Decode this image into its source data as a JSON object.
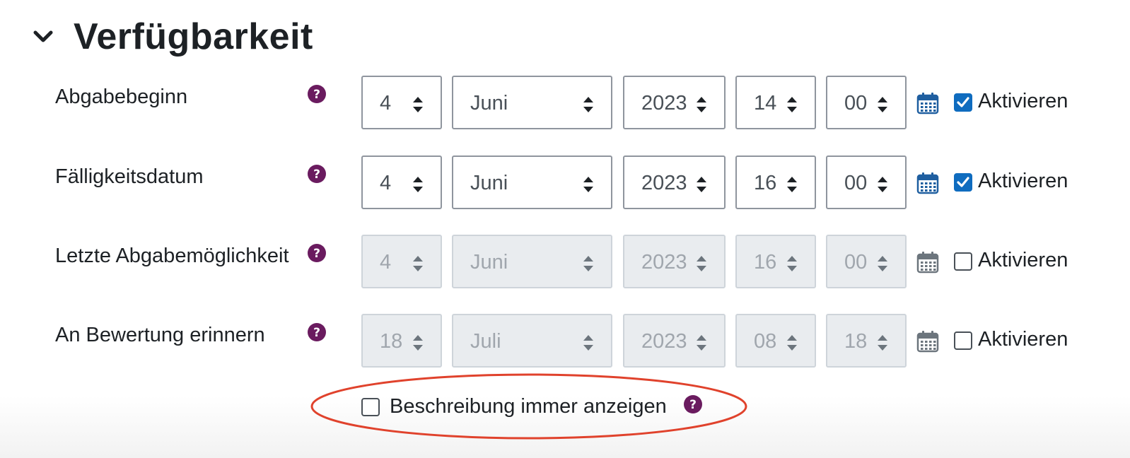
{
  "section": {
    "title": "Verfügbarkeit",
    "icon": "chevron-down-icon"
  },
  "rows": [
    {
      "label": "Abgabebeginn",
      "day": "4",
      "month": "Juni",
      "year": "2023",
      "hour": "14",
      "minute": "00",
      "enabled": true,
      "enable_label": "Aktivieren"
    },
    {
      "label": "Fälligkeitsdatum",
      "day": "4",
      "month": "Juni",
      "year": "2023",
      "hour": "16",
      "minute": "00",
      "enabled": true,
      "enable_label": "Aktivieren"
    },
    {
      "label": "Letzte Abgabemöglichkeit",
      "day": "4",
      "month": "Juni",
      "year": "2023",
      "hour": "16",
      "minute": "00",
      "enabled": false,
      "enable_label": "Aktivieren"
    },
    {
      "label": "An Bewertung erinnern",
      "day": "18",
      "month": "Juli",
      "year": "2023",
      "hour": "08",
      "minute": "18",
      "enabled": false,
      "enable_label": "Aktivieren"
    }
  ],
  "always_show_description": {
    "label": "Beschreibung immer anzeigen",
    "checked": false
  },
  "colors": {
    "help_icon": "#6a1b5f",
    "checkbox_accent": "#0f6cbf",
    "calendar_enabled": "#1f5fa0",
    "calendar_disabled": "#6c757d",
    "highlight_ellipse": "#e0422c"
  },
  "icons": {
    "help": "question-circle-icon",
    "calendar": "calendar-icon",
    "select": "sort-arrows-icon"
  }
}
